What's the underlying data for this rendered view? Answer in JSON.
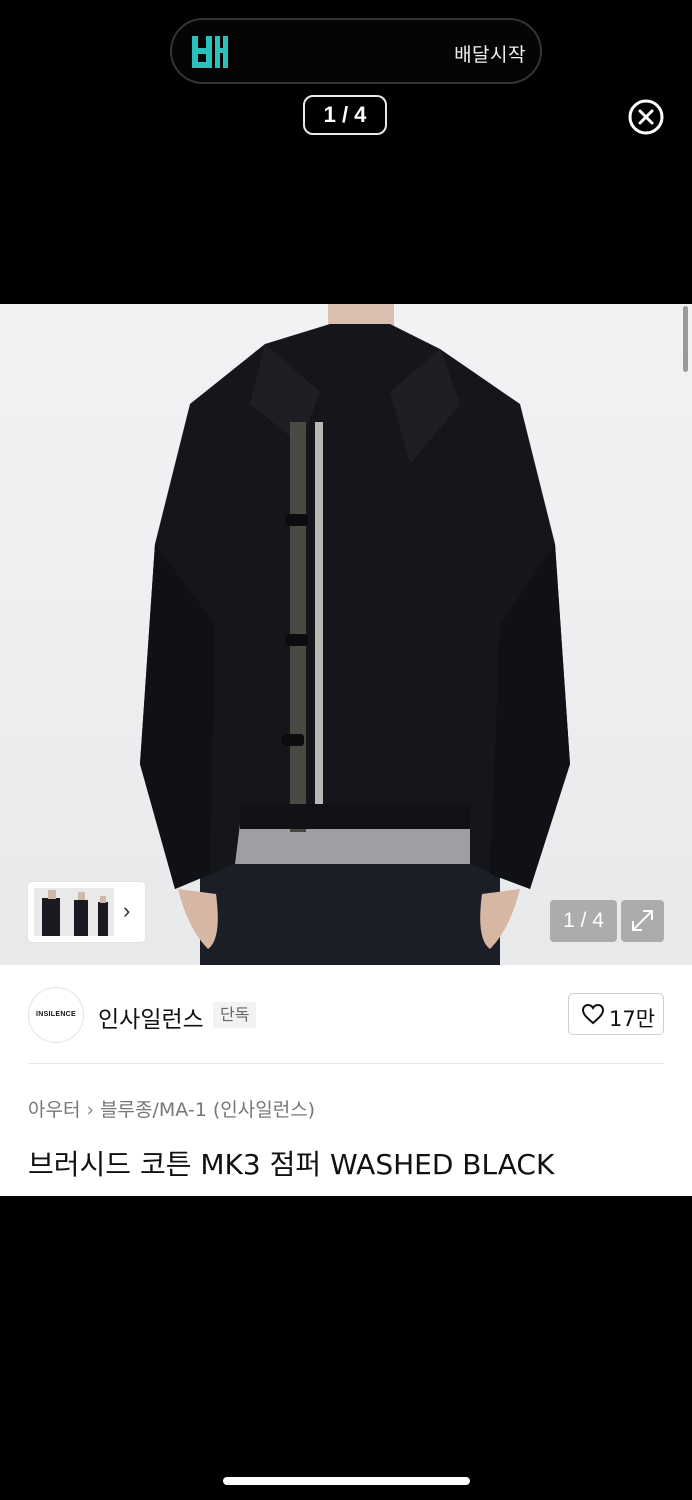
{
  "banner": {
    "logo_icon": "baemin-logo-icon",
    "logo_color": "#2AC1BC",
    "text": "배달시작"
  },
  "viewer": {
    "counter": "1 / 4",
    "close_icon": "close-circle-icon"
  },
  "gallery": {
    "image_icon": "product-photo-jacket",
    "counter": "1 / 4",
    "thumbnail_next_icon": "chevron-right-icon",
    "expand_icon": "expand-icon"
  },
  "product": {
    "brand_logo_text": "INSILENCE",
    "brand_name": "인사일런스",
    "exclusive_badge": "단독",
    "like_count": "17만",
    "breadcrumb": [
      "아우터",
      "블루종/MA-1 (인사일런스)"
    ],
    "title": "브러시드 코튼 MK3 점퍼 WASHED BLACK"
  }
}
